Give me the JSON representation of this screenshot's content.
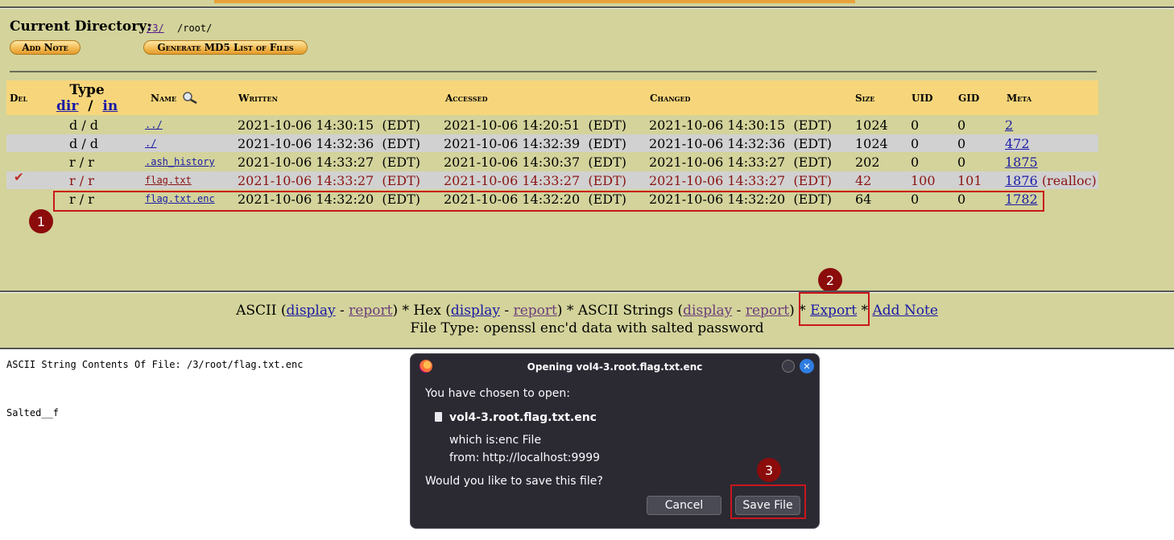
{
  "header": {
    "current_directory_label": "Current Directory:",
    "dir_link": "/3/",
    "dir_path": "/root/",
    "add_note_button": "Add Note",
    "md5_button": "Generate MD5 List of Files"
  },
  "table": {
    "headers": {
      "del": "Del",
      "type": "Type",
      "type_dir": "dir",
      "type_slash": "/",
      "type_in": "in",
      "name": "Name",
      "written": "Written",
      "accessed": "Accessed",
      "changed": "Changed",
      "size": "Size",
      "uid": "UID",
      "gid": "GID",
      "meta": "Meta"
    },
    "rows": [
      {
        "del": "",
        "type": "d / d",
        "name": "../",
        "written": "2021-10-06 14:30:15  (EDT)",
        "accessed": "2021-10-06 14:20:51  (EDT)",
        "changed": "2021-10-06 14:30:15  (EDT)",
        "size": "1024",
        "uid": "0",
        "gid": "0",
        "meta": "2",
        "meta_note": ""
      },
      {
        "del": "",
        "type": "d / d",
        "name": "./",
        "written": "2021-10-06 14:32:36  (EDT)",
        "accessed": "2021-10-06 14:32:39  (EDT)",
        "changed": "2021-10-06 14:32:36  (EDT)",
        "size": "1024",
        "uid": "0",
        "gid": "0",
        "meta": "472",
        "meta_note": ""
      },
      {
        "del": "",
        "type": "r / r",
        "name": ".ash_history",
        "written": "2021-10-06 14:33:27  (EDT)",
        "accessed": "2021-10-06 14:30:37  (EDT)",
        "changed": "2021-10-06 14:33:27  (EDT)",
        "size": "202",
        "uid": "0",
        "gid": "0",
        "meta": "1875",
        "meta_note": ""
      },
      {
        "del": "✔",
        "type": "r / r",
        "name": "flag.txt",
        "written": "2021-10-06 14:33:27  (EDT)",
        "accessed": "2021-10-06 14:33:27  (EDT)",
        "changed": "2021-10-06 14:33:27  (EDT)",
        "size": "42",
        "uid": "100",
        "gid": "101",
        "meta": "1876",
        "meta_note": "(realloc)"
      },
      {
        "del": "",
        "type": "r / r",
        "name": "flag.txt.enc",
        "written": "2021-10-06 14:32:20  (EDT)",
        "accessed": "2021-10-06 14:32:20  (EDT)",
        "changed": "2021-10-06 14:32:20  (EDT)",
        "size": "64",
        "uid": "0",
        "gid": "0",
        "meta": "1782",
        "meta_note": ""
      }
    ]
  },
  "markers": {
    "one": "1",
    "two": "2",
    "three": "3"
  },
  "file_actions": {
    "ascii_label": "ASCII (",
    "ascii_display": "display",
    "dash": " - ",
    "ascii_report": "report",
    "hex_label": ") * Hex (",
    "hex_display": "display",
    "hex_report": "report",
    "strings_label": ") * ASCII Strings (",
    "strings_display": "display",
    "strings_report": "report",
    "close_star": ") * ",
    "export": "Export",
    "star": " * ",
    "add_note": "Add Note",
    "file_type": "File Type: openssl enc'd data with salted password"
  },
  "content": {
    "heading": "ASCII String Contents Of File: /3/root/flag.txt.enc",
    "body": "Salted__f"
  },
  "dialog": {
    "title": "Opening vol4-3.root.flag.txt.enc",
    "chosen_label": "You have chosen to open:",
    "filename": "vol4-3.root.flag.txt.enc",
    "which_is_label": "which is:",
    "which_is_value": "enc File",
    "from_label": "from:",
    "from_value": "http://localhost:9999",
    "question": "Would you like to save this file?",
    "cancel_label": "Cancel",
    "save_label": "Save File",
    "close_glyph": "✕"
  },
  "colors": {
    "frame_bg": "#d3d39b",
    "header_bg": "#f7d67b",
    "alt_row": "#d1d1d1",
    "deleted_text": "#8b1414",
    "annotation_red": "#c9161d",
    "dialog_bg": "#2b2a33"
  }
}
